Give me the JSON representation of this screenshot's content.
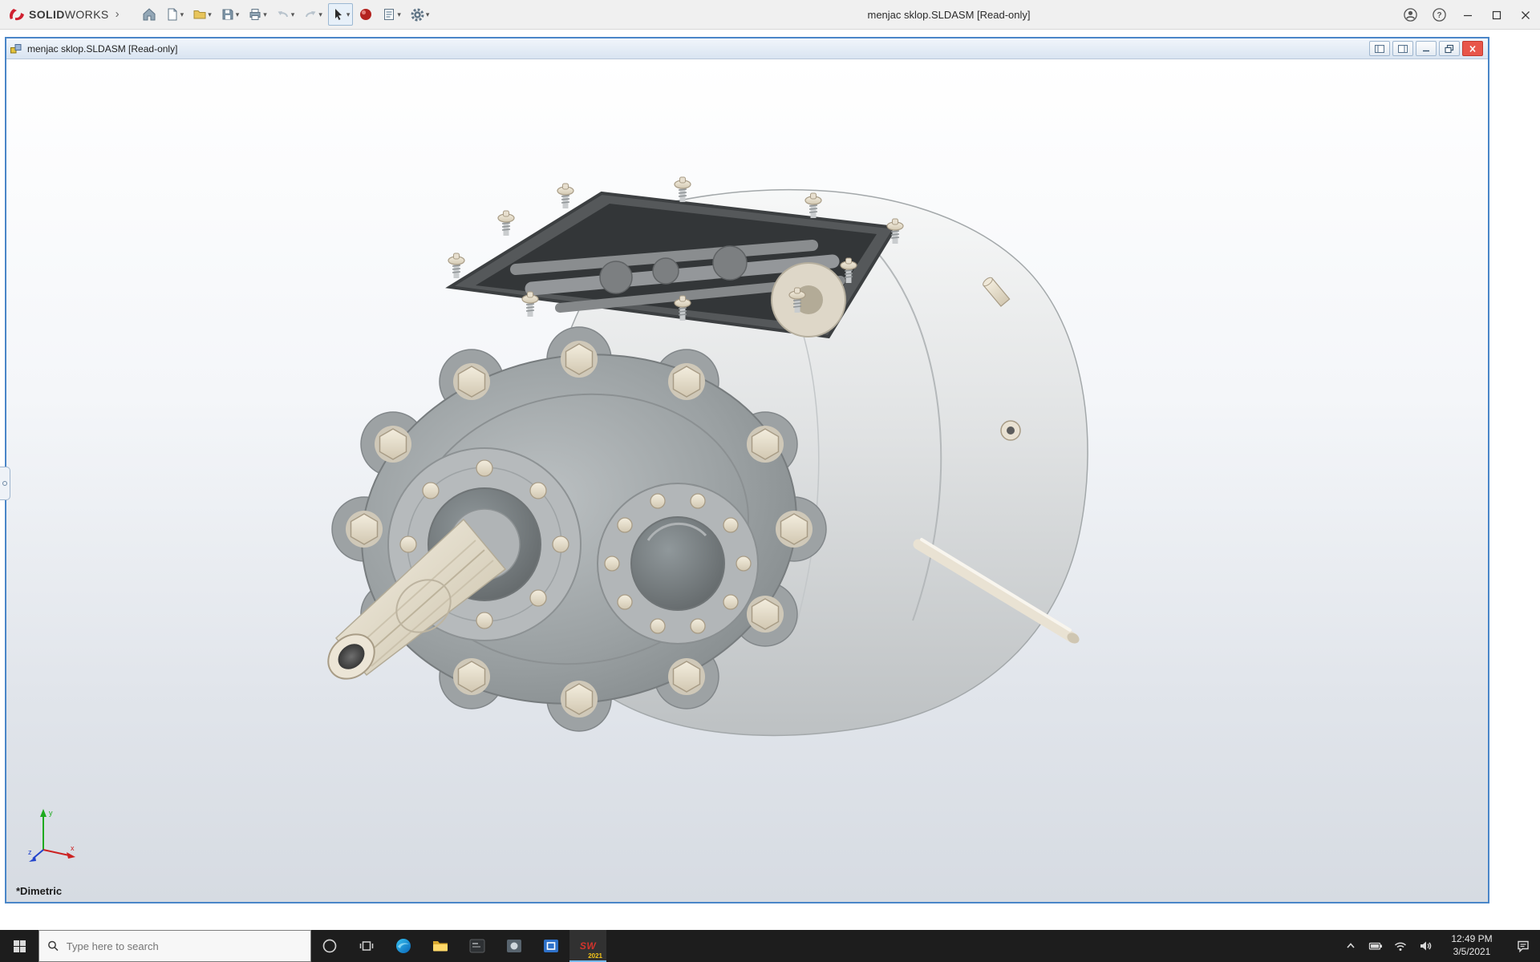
{
  "app": {
    "brand": {
      "bold": "SOLID",
      "light": "WORKS",
      "expand": "›"
    },
    "title": "menjac sklop.SLDASM [Read-only]",
    "caption": {
      "help": "?"
    }
  },
  "icons": {
    "caret": "▾"
  },
  "document": {
    "title": "menjac sklop.SLDASM [Read-only]"
  },
  "viewport": {
    "view_label": "*Dimetric",
    "triad": {
      "x": "x",
      "y": "y",
      "z": "z"
    }
  },
  "taskbar": {
    "search_placeholder": "Type here to search",
    "sw_label": "SW",
    "solidworks_badge": "2021",
    "clock": {
      "time": "12:49 PM",
      "date": "3/5/2021"
    }
  },
  "colors": {
    "accent_border": "#4a86c8",
    "taskbar_bg": "#1d1d1d",
    "brand_red": "#cf2030",
    "close_red": "#e8564a",
    "viewport_gradient_bottom": "#d6dbe2"
  }
}
